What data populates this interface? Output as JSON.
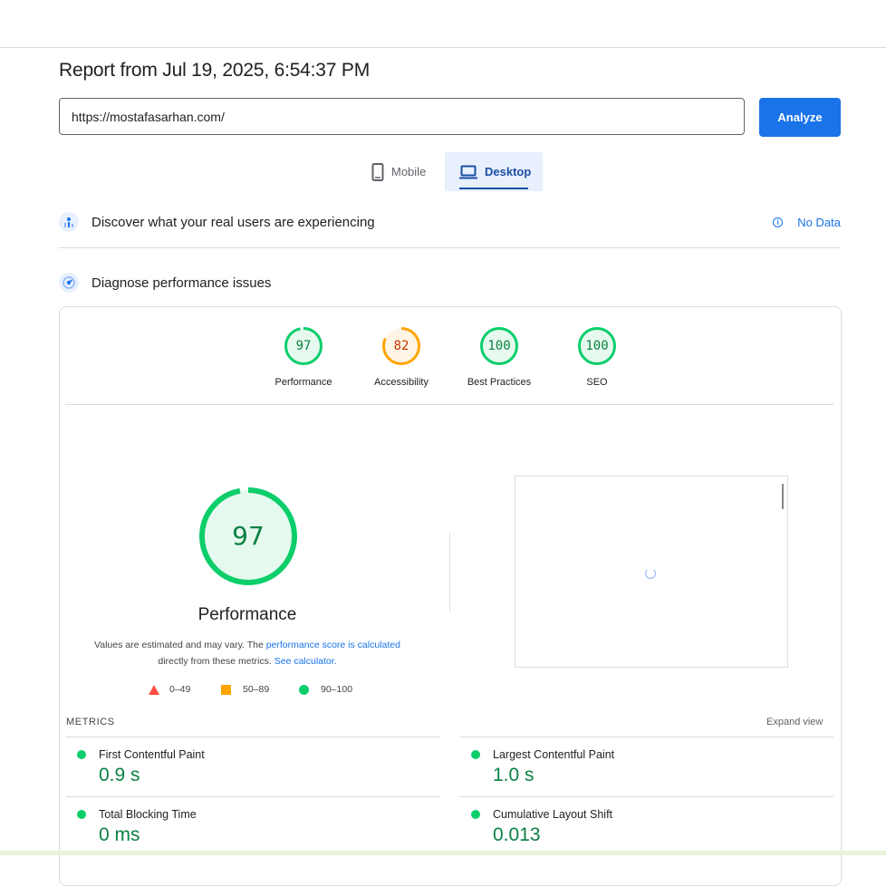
{
  "report": {
    "title": "Report from Jul 19, 2025, 6:54:37 PM"
  },
  "search": {
    "url_value": "https://mostafasarhan.com/",
    "analyze_label": "Analyze"
  },
  "tabs": [
    {
      "label": "Mobile",
      "icon": "phone-icon",
      "selected": false
    },
    {
      "label": "Desktop",
      "icon": "laptop-icon",
      "selected": true
    }
  ],
  "discover": {
    "title": "Discover what your real users are experiencing",
    "status": "No Data",
    "icon": "users-chart-icon"
  },
  "diagnose": {
    "title": "Diagnose performance issues",
    "icon": "gauge-icon"
  },
  "scores": [
    {
      "label": "Performance",
      "value": "97",
      "fraction": 0.97,
      "color": "#0cce6b",
      "text_color": "#0b8043",
      "bg": "#e6f9ee"
    },
    {
      "label": "Accessibility",
      "value": "82",
      "fraction": 0.82,
      "color": "#ffa400",
      "text_color": "#c33300",
      "bg": "#fff5e6"
    },
    {
      "label": "Best Practices",
      "value": "100",
      "fraction": 1.0,
      "color": "#0cce6b",
      "text_color": "#0b8043",
      "bg": "#e6f9ee"
    },
    {
      "label": "SEO",
      "value": "100",
      "fraction": 1.0,
      "color": "#0cce6b",
      "text_color": "#0b8043",
      "bg": "#e6f9ee"
    }
  ],
  "performance": {
    "score": "97",
    "label": "Performance",
    "explain_prefix": "Values are estimated and may vary. The ",
    "explain_link1": "performance score is calculated",
    "explain_mid": "directly from these metrics. ",
    "explain_link2": "See calculator."
  },
  "legend": [
    {
      "range": "0–49",
      "shape": "triangle",
      "color": "#ff4e42"
    },
    {
      "range": "50–89",
      "shape": "square",
      "color": "#ffa400"
    },
    {
      "range": "90–100",
      "shape": "circle",
      "color": "#0cce6b"
    }
  ],
  "metrics": {
    "heading": "METRICS",
    "expand_label": "Expand view",
    "items": [
      {
        "name": "First Contentful Paint",
        "value": "0.9 s"
      },
      {
        "name": "Largest Contentful Paint",
        "value": "1.0 s"
      },
      {
        "name": "Total Blocking Time",
        "value": "0 ms"
      },
      {
        "name": "Cumulative Layout Shift",
        "value": "0.013"
      }
    ]
  }
}
